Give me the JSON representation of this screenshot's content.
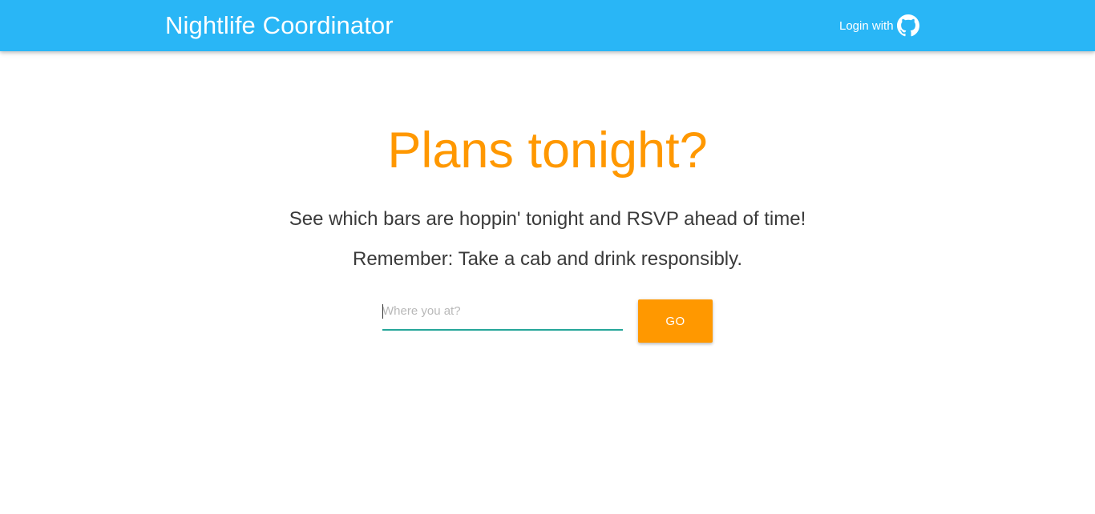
{
  "navbar": {
    "brand": "Nightlife Coordinator",
    "login_label": "Login with",
    "login_icon": "github-icon",
    "background_color": "#29b6f6"
  },
  "hero": {
    "headline": "Plans tonight?",
    "subtitle": "See which bars are hoppin' tonight and RSVP ahead of time!",
    "reminder": "Remember: Take a cab and drink responsibly.",
    "headline_color": "#ff9800"
  },
  "search": {
    "placeholder": "Where you at?",
    "value": "",
    "underline_color": "#26a69a",
    "button_label": "GO",
    "button_color": "#ff9800"
  }
}
